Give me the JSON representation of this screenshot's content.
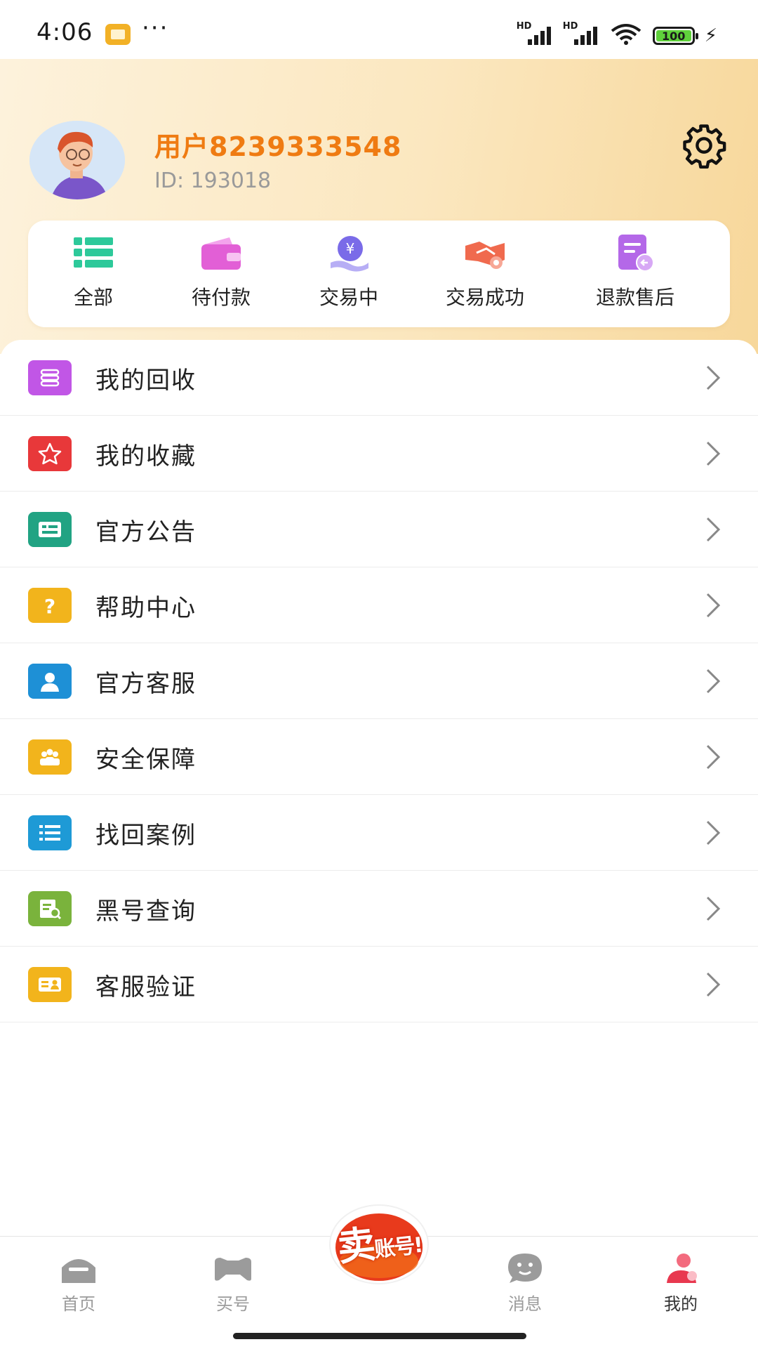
{
  "status_bar": {
    "time": "4:06",
    "dots": "···",
    "network_1": "HD",
    "network_2": "HD",
    "battery": "100"
  },
  "profile": {
    "username": "用户8239333548",
    "id_text": "ID: 193018",
    "icons": {
      "avatar": "avatar-illustration",
      "settings": "gear-icon"
    }
  },
  "orders": [
    {
      "label": "全部",
      "icon": "list-icon",
      "color": "#2dc99a"
    },
    {
      "label": "待付款",
      "icon": "wallet-icon",
      "color": "#e25fd6"
    },
    {
      "label": "交易中",
      "icon": "yuan-hand-icon",
      "color": "#7a6be8"
    },
    {
      "label": "交易成功",
      "icon": "handshake-icon",
      "color": "#f06a4e"
    },
    {
      "label": "退款售后",
      "icon": "refund-doc-icon",
      "color": "#b468e8"
    }
  ],
  "menu": [
    {
      "label": "我的回收",
      "icon": "recycle-icon",
      "color": "#c156e6"
    },
    {
      "label": "我的收藏",
      "icon": "star-icon",
      "color": "#e8383a"
    },
    {
      "label": "官方公告",
      "icon": "announcement-icon",
      "color": "#21a383"
    },
    {
      "label": "帮助中心",
      "icon": "question-icon",
      "color": "#f2b41c"
    },
    {
      "label": "官方客服",
      "icon": "support-agent-icon",
      "color": "#1e90d6"
    },
    {
      "label": "安全保障",
      "icon": "security-group-icon",
      "color": "#f2b41c"
    },
    {
      "label": "找回案例",
      "icon": "case-list-icon",
      "color": "#1e9ad6"
    },
    {
      "label": "黑号查询",
      "icon": "search-doc-icon",
      "color": "#7ab33c"
    },
    {
      "label": "客服验证",
      "icon": "id-card-icon",
      "color": "#f2b41c"
    }
  ],
  "tabbar": {
    "tabs": [
      {
        "label": "首页",
        "icon": "home-icon",
        "active": false
      },
      {
        "label": "买号",
        "icon": "gamepad-icon",
        "active": false
      },
      {
        "label": "消息",
        "icon": "chat-icon",
        "active": false
      },
      {
        "label": "我的",
        "icon": "profile-icon",
        "active": true
      }
    ],
    "sell_label": "卖账号!",
    "sell_main": "卖",
    "sell_sub": "账号!"
  },
  "colors": {
    "username": "#ef7b12",
    "header_gradient": [
      "#fdf2dc",
      "#f7d79a"
    ],
    "sell_button": "#e83a1c"
  }
}
